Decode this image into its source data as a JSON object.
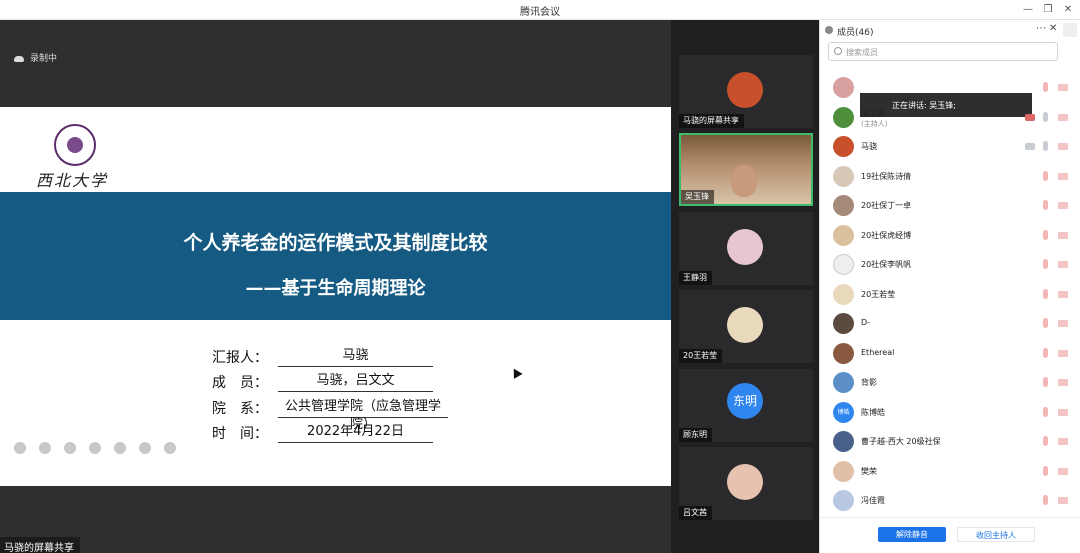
{
  "window": {
    "title": "腾讯会议"
  },
  "share": {
    "recording": "录制中",
    "caption": "马骁的屏幕共享",
    "slide": {
      "logo_text": "西北大学",
      "title": "个人养老金的运作模式及其制度比较",
      "subtitle": "——基于生命周期理论",
      "rows": [
        {
          "label": "汇报人：",
          "value": "马骁"
        },
        {
          "label": "成　员：",
          "value": "马骁，吕文文"
        },
        {
          "label": "院　系：",
          "value": "公共管理学院（应急管理学院）"
        },
        {
          "label": "时　间：",
          "value": "2022年4月22日"
        }
      ]
    }
  },
  "videos": [
    {
      "label": "马骁的屏幕共享",
      "color": "#c8502a"
    },
    {
      "label": "吴玉锋",
      "color": "#b48a64"
    },
    {
      "label": "王静羽",
      "color": "#e8c6cf"
    },
    {
      "label": "20王若莹",
      "color": "#e9d9bd"
    },
    {
      "label": "顾东明",
      "avatar_text": "东明",
      "color": "#2f86ef"
    },
    {
      "label": "吕文茜",
      "color": "#e7c2b0"
    }
  ],
  "panel": {
    "title": "成员(46)",
    "search_placeholder": "搜索成员",
    "speaking": "正在讲话: 吴玉锋;",
    "members": [
      {
        "name": "",
        "color": "#d9a0a0"
      },
      {
        "name": "吴玉锋",
        "sub": "(主持人)",
        "color": "#4f8f3c"
      },
      {
        "name": "马骁",
        "color": "#c8502a"
      },
      {
        "name": "19社保陈诗倩",
        "color": "#d8c8b8"
      },
      {
        "name": "20社保丁一卓",
        "color": "#a58a7a"
      },
      {
        "name": "20社保虎经博",
        "color": "#d9c19d"
      },
      {
        "name": "20社保李帆帆",
        "color": "#eeeeee"
      },
      {
        "name": "20王若莹",
        "color": "#e9d9bd"
      },
      {
        "name": "D-",
        "color": "#5a4a40"
      },
      {
        "name": "Ethereal",
        "color": "#8a5a40"
      },
      {
        "name": "背影",
        "color": "#5c8fc7"
      },
      {
        "name": "陈博皓",
        "avatar_text": "博皓",
        "color": "#2f86ef"
      },
      {
        "name": "曹子越-西大 20级社保",
        "color": "#48608a"
      },
      {
        "name": "樊荣",
        "color": "#e0c0a8"
      },
      {
        "name": "冯佳霞",
        "color": "#b8c8e0"
      }
    ],
    "unmute_button": "解除静音",
    "reclaim_host_button": "收回主持人"
  }
}
